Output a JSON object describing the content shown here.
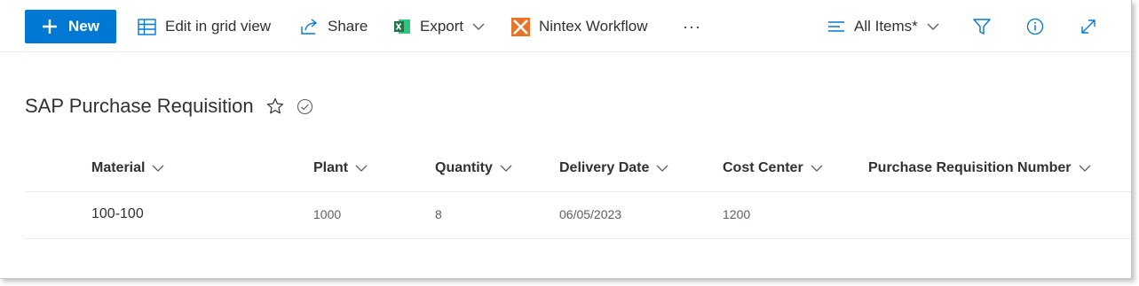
{
  "toolbar": {
    "new_label": "New",
    "edit_grid_label": "Edit in grid view",
    "share_label": "Share",
    "export_label": "Export",
    "nintex_label": "Nintex Workflow",
    "more_label": "···",
    "view_label": "All Items*"
  },
  "list": {
    "title": "SAP Purchase Requisition",
    "columns": [
      "Material",
      "Plant",
      "Quantity",
      "Delivery Date",
      "Cost Center",
      "Purchase Requisition Number"
    ],
    "rows": [
      [
        "100-100",
        "1000",
        "8",
        "06/05/2023",
        "1200",
        ""
      ]
    ]
  },
  "colors": {
    "accent": "#0078d4",
    "excel_green": "#217346",
    "nintex_orange": "#e8742a"
  }
}
